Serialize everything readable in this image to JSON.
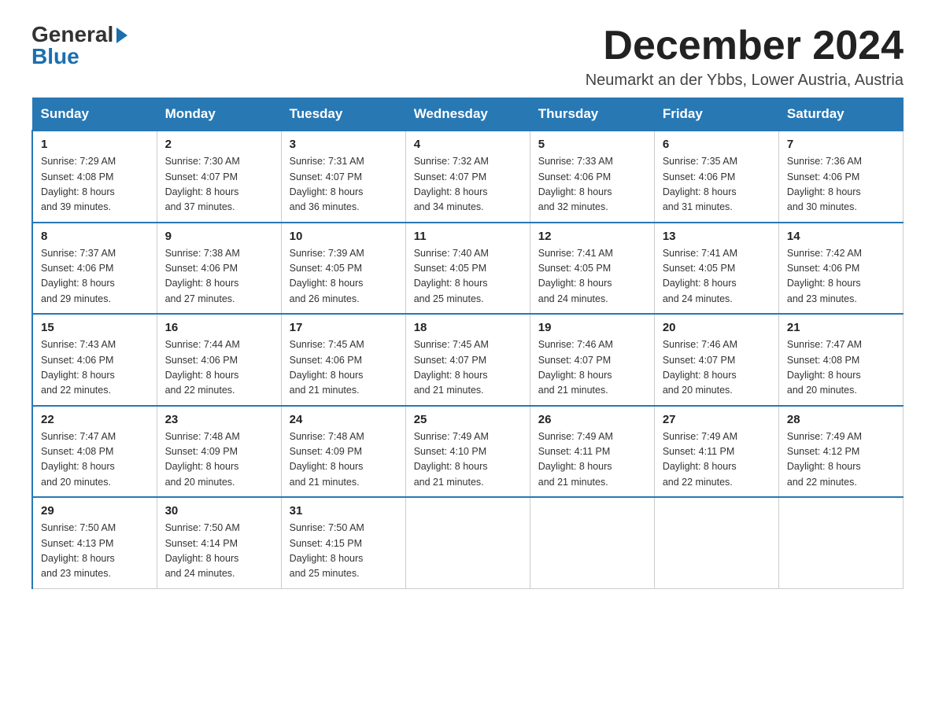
{
  "logo": {
    "general": "General",
    "blue": "Blue"
  },
  "title": "December 2024",
  "location": "Neumarkt an der Ybbs, Lower Austria, Austria",
  "headers": [
    "Sunday",
    "Monday",
    "Tuesday",
    "Wednesday",
    "Thursday",
    "Friday",
    "Saturday"
  ],
  "weeks": [
    [
      {
        "day": "1",
        "info": "Sunrise: 7:29 AM\nSunset: 4:08 PM\nDaylight: 8 hours\nand 39 minutes."
      },
      {
        "day": "2",
        "info": "Sunrise: 7:30 AM\nSunset: 4:07 PM\nDaylight: 8 hours\nand 37 minutes."
      },
      {
        "day": "3",
        "info": "Sunrise: 7:31 AM\nSunset: 4:07 PM\nDaylight: 8 hours\nand 36 minutes."
      },
      {
        "day": "4",
        "info": "Sunrise: 7:32 AM\nSunset: 4:07 PM\nDaylight: 8 hours\nand 34 minutes."
      },
      {
        "day": "5",
        "info": "Sunrise: 7:33 AM\nSunset: 4:06 PM\nDaylight: 8 hours\nand 32 minutes."
      },
      {
        "day": "6",
        "info": "Sunrise: 7:35 AM\nSunset: 4:06 PM\nDaylight: 8 hours\nand 31 minutes."
      },
      {
        "day": "7",
        "info": "Sunrise: 7:36 AM\nSunset: 4:06 PM\nDaylight: 8 hours\nand 30 minutes."
      }
    ],
    [
      {
        "day": "8",
        "info": "Sunrise: 7:37 AM\nSunset: 4:06 PM\nDaylight: 8 hours\nand 29 minutes."
      },
      {
        "day": "9",
        "info": "Sunrise: 7:38 AM\nSunset: 4:06 PM\nDaylight: 8 hours\nand 27 minutes."
      },
      {
        "day": "10",
        "info": "Sunrise: 7:39 AM\nSunset: 4:05 PM\nDaylight: 8 hours\nand 26 minutes."
      },
      {
        "day": "11",
        "info": "Sunrise: 7:40 AM\nSunset: 4:05 PM\nDaylight: 8 hours\nand 25 minutes."
      },
      {
        "day": "12",
        "info": "Sunrise: 7:41 AM\nSunset: 4:05 PM\nDaylight: 8 hours\nand 24 minutes."
      },
      {
        "day": "13",
        "info": "Sunrise: 7:41 AM\nSunset: 4:05 PM\nDaylight: 8 hours\nand 24 minutes."
      },
      {
        "day": "14",
        "info": "Sunrise: 7:42 AM\nSunset: 4:06 PM\nDaylight: 8 hours\nand 23 minutes."
      }
    ],
    [
      {
        "day": "15",
        "info": "Sunrise: 7:43 AM\nSunset: 4:06 PM\nDaylight: 8 hours\nand 22 minutes."
      },
      {
        "day": "16",
        "info": "Sunrise: 7:44 AM\nSunset: 4:06 PM\nDaylight: 8 hours\nand 22 minutes."
      },
      {
        "day": "17",
        "info": "Sunrise: 7:45 AM\nSunset: 4:06 PM\nDaylight: 8 hours\nand 21 minutes."
      },
      {
        "day": "18",
        "info": "Sunrise: 7:45 AM\nSunset: 4:07 PM\nDaylight: 8 hours\nand 21 minutes."
      },
      {
        "day": "19",
        "info": "Sunrise: 7:46 AM\nSunset: 4:07 PM\nDaylight: 8 hours\nand 21 minutes."
      },
      {
        "day": "20",
        "info": "Sunrise: 7:46 AM\nSunset: 4:07 PM\nDaylight: 8 hours\nand 20 minutes."
      },
      {
        "day": "21",
        "info": "Sunrise: 7:47 AM\nSunset: 4:08 PM\nDaylight: 8 hours\nand 20 minutes."
      }
    ],
    [
      {
        "day": "22",
        "info": "Sunrise: 7:47 AM\nSunset: 4:08 PM\nDaylight: 8 hours\nand 20 minutes."
      },
      {
        "day": "23",
        "info": "Sunrise: 7:48 AM\nSunset: 4:09 PM\nDaylight: 8 hours\nand 20 minutes."
      },
      {
        "day": "24",
        "info": "Sunrise: 7:48 AM\nSunset: 4:09 PM\nDaylight: 8 hours\nand 21 minutes."
      },
      {
        "day": "25",
        "info": "Sunrise: 7:49 AM\nSunset: 4:10 PM\nDaylight: 8 hours\nand 21 minutes."
      },
      {
        "day": "26",
        "info": "Sunrise: 7:49 AM\nSunset: 4:11 PM\nDaylight: 8 hours\nand 21 minutes."
      },
      {
        "day": "27",
        "info": "Sunrise: 7:49 AM\nSunset: 4:11 PM\nDaylight: 8 hours\nand 22 minutes."
      },
      {
        "day": "28",
        "info": "Sunrise: 7:49 AM\nSunset: 4:12 PM\nDaylight: 8 hours\nand 22 minutes."
      }
    ],
    [
      {
        "day": "29",
        "info": "Sunrise: 7:50 AM\nSunset: 4:13 PM\nDaylight: 8 hours\nand 23 minutes."
      },
      {
        "day": "30",
        "info": "Sunrise: 7:50 AM\nSunset: 4:14 PM\nDaylight: 8 hours\nand 24 minutes."
      },
      {
        "day": "31",
        "info": "Sunrise: 7:50 AM\nSunset: 4:15 PM\nDaylight: 8 hours\nand 25 minutes."
      },
      null,
      null,
      null,
      null
    ]
  ]
}
